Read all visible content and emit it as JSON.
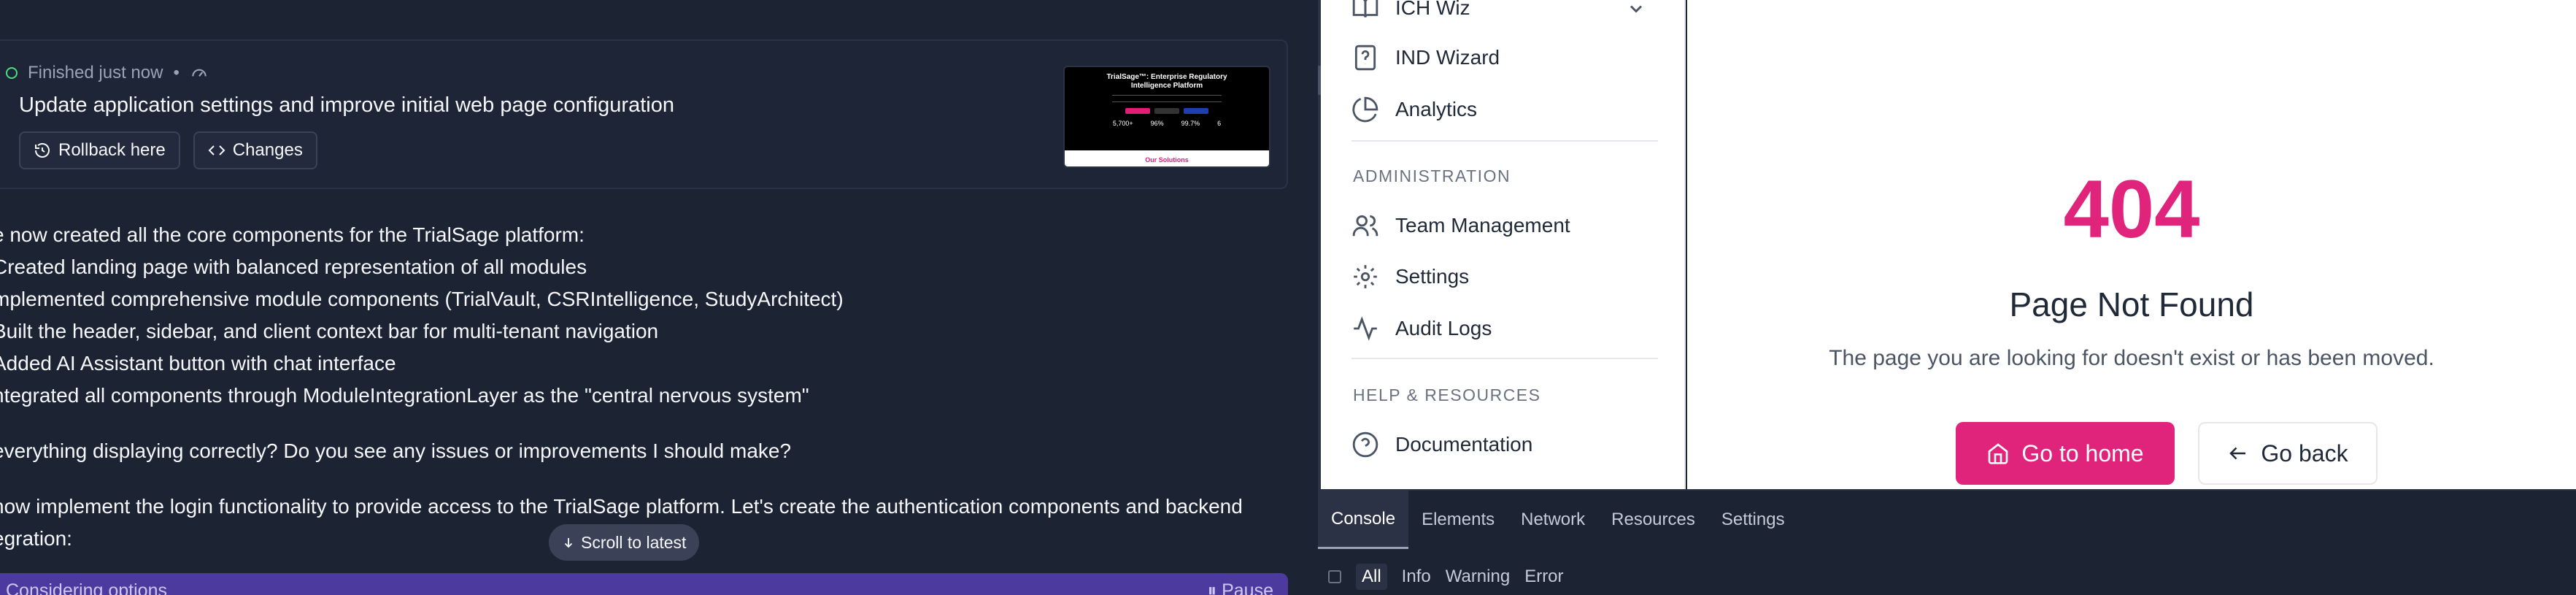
{
  "chat": {
    "status": "Finished just now",
    "status_sep": "•",
    "title": "Update application settings and improve initial web page configuration",
    "rollback_label": "Rollback here",
    "changes_label": "Changes",
    "thumbnail": {
      "title": "TrialSage™: Enterprise Regulatory Intelligence Platform",
      "stats": [
        "5,700+",
        "96%",
        "99.7%",
        "6"
      ],
      "footer": "Our Solutions"
    },
    "message_lines": [
      "e now created all the core components for the TrialSage platform:",
      "Created landing page with balanced representation of all modules",
      "mplemented comprehensive module components (TrialVault, CSRIntelligence, StudyArchitect)",
      "Built the header, sidebar, and client context bar for multi-tenant navigation",
      "Added AI Assistant button with chat interface",
      "ntegrated all components through ModuleIntegrationLayer as the \"central nervous system\"",
      "everything displaying correctly? Do you see any issues or improvements I should make?",
      "now implement the login functionality to provide access to the TrialSage platform. Let's create the authentication components and backend",
      "egration:"
    ],
    "scroll_label": "Scroll to latest",
    "considering_label": "Considering options",
    "pause_label": "⏸ Pause"
  },
  "sidebar": {
    "items_top": [
      {
        "label": "ICH Wiz",
        "icon": "book-icon"
      },
      {
        "label": "IND Wizard",
        "icon": "help-file-icon"
      },
      {
        "label": "Analytics",
        "icon": "pie-chart-icon"
      }
    ],
    "admin_label": "ADMINISTRATION",
    "items_admin": [
      {
        "label": "Team Management",
        "icon": "users-icon"
      },
      {
        "label": "Settings",
        "icon": "gear-icon"
      },
      {
        "label": "Audit Logs",
        "icon": "activity-icon"
      }
    ],
    "help_label": "HELP & RESOURCES",
    "items_help": [
      {
        "label": "Documentation",
        "icon": "help-circle-icon"
      }
    ]
  },
  "main": {
    "code": "404",
    "title": "Page Not Found",
    "description": "The page you are looking for doesn't exist or has been moved.",
    "home_label": "Go to home",
    "back_label": "Go back"
  },
  "devtools": {
    "tabs": [
      "Console",
      "Elements",
      "Network",
      "Resources",
      "Settings"
    ],
    "active_tab": "Console",
    "filters": [
      "All",
      "Info",
      "Warning",
      "Error"
    ],
    "active_filter": "All"
  },
  "colors": {
    "accent_pink": "#e0237b",
    "chat_bg": "#1c2333",
    "considering_bg": "#4c3a9e"
  }
}
